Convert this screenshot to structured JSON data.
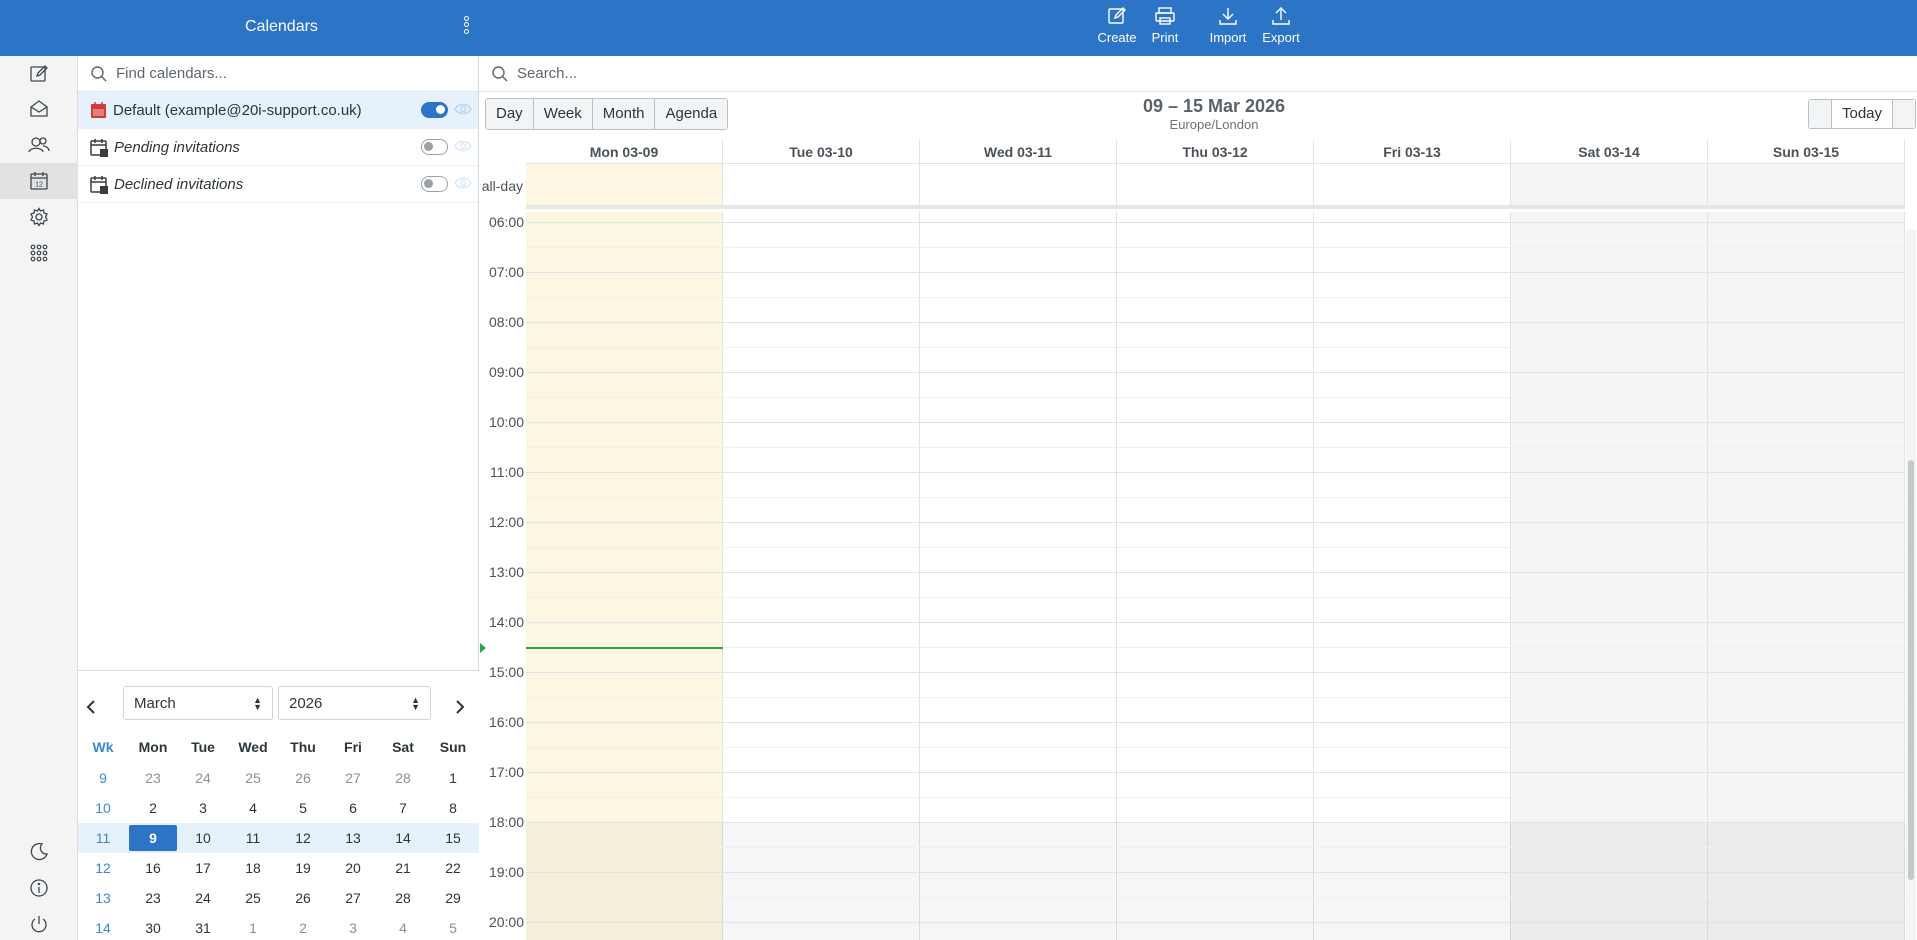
{
  "topbar": {
    "title": "Calendars",
    "buttons": [
      {
        "label": "Create",
        "icon": "edit-icon"
      },
      {
        "label": "Print",
        "icon": "print-icon"
      },
      {
        "label": "Import",
        "icon": "download-icon"
      },
      {
        "label": "Export",
        "icon": "upload-icon"
      }
    ],
    "background": "#2c74c6"
  },
  "nav": {
    "top": [
      "compose-icon",
      "mail-icon",
      "contacts-icon",
      "calendar-icon",
      "settings-icon",
      "apps-icon"
    ],
    "bottom": [
      "dark-mode-icon",
      "about-icon",
      "logout-icon"
    ],
    "active": "calendar-icon"
  },
  "calendar_list": {
    "search_placeholder": "Find calendars...",
    "items": [
      {
        "name": "Default (example@20i-support.co.uk)",
        "enabled": true,
        "italic": false,
        "color": "#d33a3a"
      },
      {
        "name": "Pending invitations",
        "enabled": false,
        "italic": true,
        "color": "#3b3b3b"
      },
      {
        "name": "Declined invitations",
        "enabled": false,
        "italic": true,
        "color": "#3b3b3b"
      }
    ]
  },
  "minical": {
    "month": "March",
    "year": "2026",
    "headers": [
      "Wk",
      "Mon",
      "Tue",
      "Wed",
      "Thu",
      "Fri",
      "Sat",
      "Sun"
    ],
    "weeks": [
      {
        "wk": "9",
        "days": [
          {
            "d": "23",
            "other": true
          },
          {
            "d": "24",
            "other": true
          },
          {
            "d": "25",
            "other": true
          },
          {
            "d": "26",
            "other": true
          },
          {
            "d": "27",
            "other": true
          },
          {
            "d": "28",
            "other": true
          },
          {
            "d": "1"
          }
        ]
      },
      {
        "wk": "10",
        "days": [
          {
            "d": "2"
          },
          {
            "d": "3"
          },
          {
            "d": "4"
          },
          {
            "d": "5"
          },
          {
            "d": "6"
          },
          {
            "d": "7"
          },
          {
            "d": "8"
          }
        ]
      },
      {
        "wk": "11",
        "current": true,
        "days": [
          {
            "d": "9",
            "today": true
          },
          {
            "d": "10"
          },
          {
            "d": "11"
          },
          {
            "d": "12"
          },
          {
            "d": "13"
          },
          {
            "d": "14"
          },
          {
            "d": "15"
          }
        ]
      },
      {
        "wk": "12",
        "days": [
          {
            "d": "16"
          },
          {
            "d": "17"
          },
          {
            "d": "18"
          },
          {
            "d": "19"
          },
          {
            "d": "20"
          },
          {
            "d": "21"
          },
          {
            "d": "22"
          }
        ]
      },
      {
        "wk": "13",
        "days": [
          {
            "d": "23"
          },
          {
            "d": "24"
          },
          {
            "d": "25"
          },
          {
            "d": "26"
          },
          {
            "d": "27"
          },
          {
            "d": "28"
          },
          {
            "d": "29"
          }
        ]
      },
      {
        "wk": "14",
        "days": [
          {
            "d": "30"
          },
          {
            "d": "31"
          },
          {
            "d": "1",
            "other": true
          },
          {
            "d": "2",
            "other": true
          },
          {
            "d": "3",
            "other": true
          },
          {
            "d": "4",
            "other": true
          },
          {
            "d": "5",
            "other": true
          }
        ]
      }
    ]
  },
  "main": {
    "search_placeholder": "Search...",
    "views": [
      "Day",
      "Week",
      "Month",
      "Agenda"
    ],
    "range_title": "09 – 15 Mar 2026",
    "timezone": "Europe/London",
    "today_label": "Today",
    "allday_label": "all-day",
    "days": [
      {
        "label": "Mon 03-09",
        "today": true,
        "weekend": false
      },
      {
        "label": "Tue 03-10",
        "today": false,
        "weekend": false
      },
      {
        "label": "Wed 03-11",
        "today": false,
        "weekend": false
      },
      {
        "label": "Thu 03-12",
        "today": false,
        "weekend": false
      },
      {
        "label": "Fri 03-13",
        "today": false,
        "weekend": false
      },
      {
        "label": "Sat 03-14",
        "today": false,
        "weekend": true
      },
      {
        "label": "Sun 03-15",
        "today": false,
        "weekend": true
      }
    ],
    "hours": [
      "06:00",
      "07:00",
      "08:00",
      "09:00",
      "10:00",
      "11:00",
      "12:00",
      "13:00",
      "14:00",
      "15:00",
      "16:00",
      "17:00",
      "18:00",
      "19:00",
      "20:00"
    ],
    "now_time": "14:30",
    "colors": {
      "today_bg": "#fdf7e2",
      "weekend_bg": "#f5f5f5",
      "now_line": "#2aa34a",
      "offhours_overlay": "rgba(0,0,0,0.035)"
    }
  }
}
